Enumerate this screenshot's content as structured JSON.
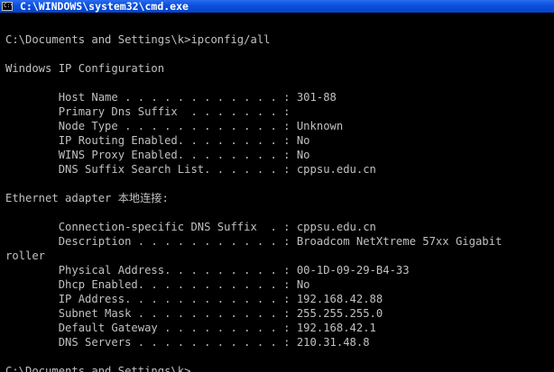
{
  "window": {
    "title": "C:\\WINDOWS\\system32\\cmd.exe",
    "icon_label": "C:\\"
  },
  "console": {
    "lines": [
      "C:\\Documents and Settings\\k>ipconfig/all",
      "",
      "Windows IP Configuration",
      "",
      "        Host Name . . . . . . . . . . . . : 301-88",
      "        Primary Dns Suffix  . . . . . . . :",
      "        Node Type . . . . . . . . . . . . : Unknown",
      "        IP Routing Enabled. . . . . . . . : No",
      "        WINS Proxy Enabled. . . . . . . . : No",
      "        DNS Suffix Search List. . . . . . : cppsu.edu.cn",
      "",
      "Ethernet adapter 本地连接:",
      "",
      "        Connection-specific DNS Suffix  . : cppsu.edu.cn",
      "        Description . . . . . . . . . . . : Broadcom NetXtreme 57xx Gigabit",
      "roller",
      "        Physical Address. . . . . . . . . : 00-1D-09-29-B4-33",
      "        Dhcp Enabled. . . . . . . . . . . : No",
      "        IP Address. . . . . . . . . . . . : 192.168.42.88",
      "        Subnet Mask . . . . . . . . . . . : 255.255.255.0",
      "        Default Gateway . . . . . . . . . : 192.168.42.1",
      "        DNS Servers . . . . . . . . . . . : 210.31.48.8",
      "",
      "C:\\Documents and Settings\\k>"
    ]
  },
  "colors": {
    "background": "#000000",
    "text": "#c0c0c0",
    "titlebar": "#0a4fdc",
    "title_text": "#ffffff"
  }
}
